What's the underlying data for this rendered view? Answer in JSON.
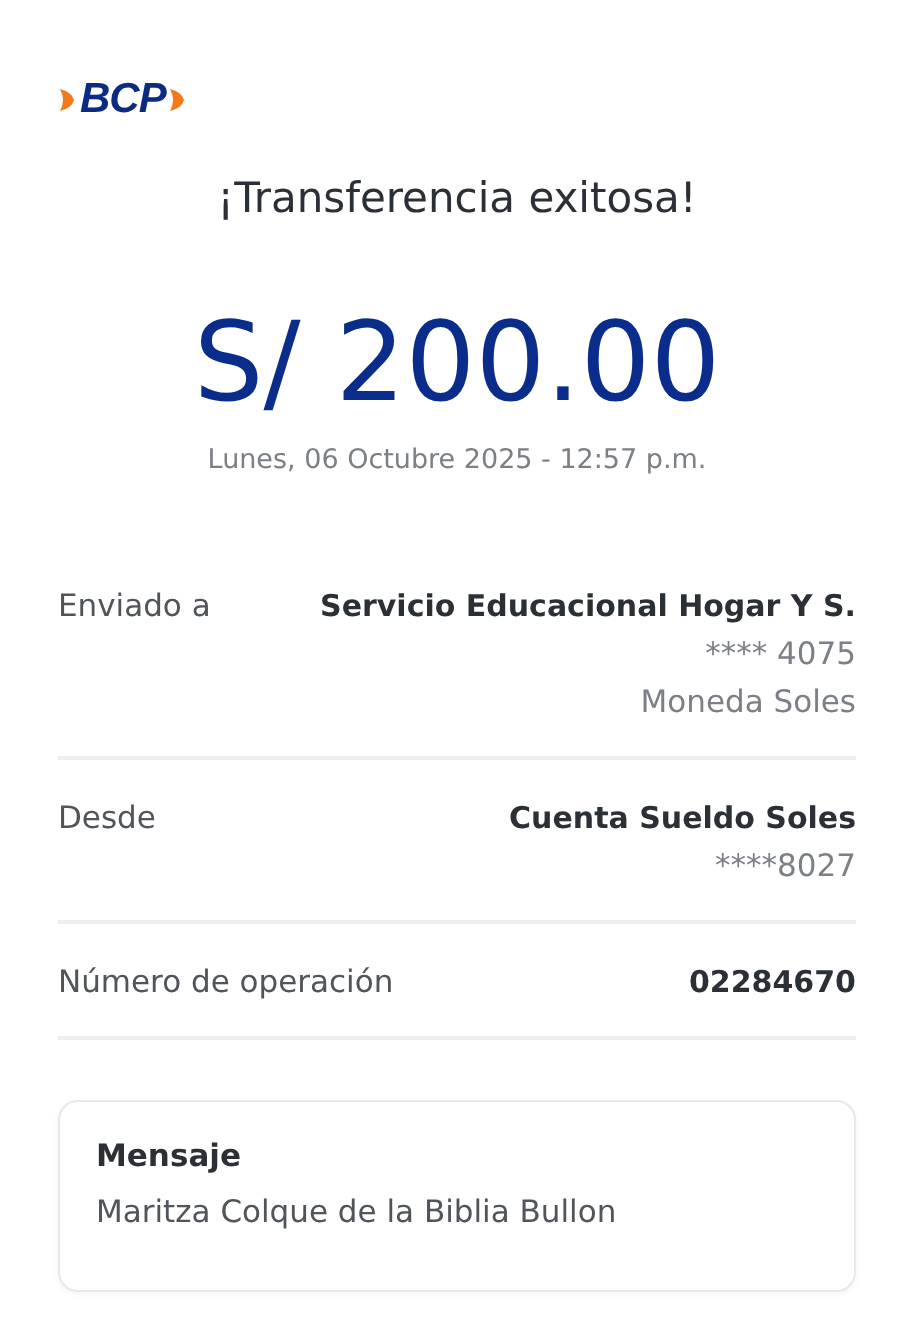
{
  "logo": {
    "text": "BCP"
  },
  "title": "¡Transferencia exitosa!",
  "amount": "S/ 200.00",
  "date": "Lunes, 06 Octubre 2025 - 12:57 p.m.",
  "details": [
    {
      "label": "Enviado a",
      "values": [
        {
          "text": "Servicio Educacional Hogar Y S.",
          "kind": "primary"
        },
        {
          "text": "**** 4075",
          "kind": "secondary"
        },
        {
          "text": "Moneda Soles",
          "kind": "secondary"
        }
      ]
    },
    {
      "label": "Desde",
      "values": [
        {
          "text": "Cuenta Sueldo Soles",
          "kind": "primary"
        },
        {
          "text": "****8027",
          "kind": "secondary"
        }
      ]
    },
    {
      "label": "Número de operación",
      "values": [
        {
          "text": "02284670",
          "kind": "primary"
        }
      ]
    }
  ],
  "message": {
    "heading": "Mensaje",
    "text": "Maritza Colque de la Biblia Bullon"
  }
}
